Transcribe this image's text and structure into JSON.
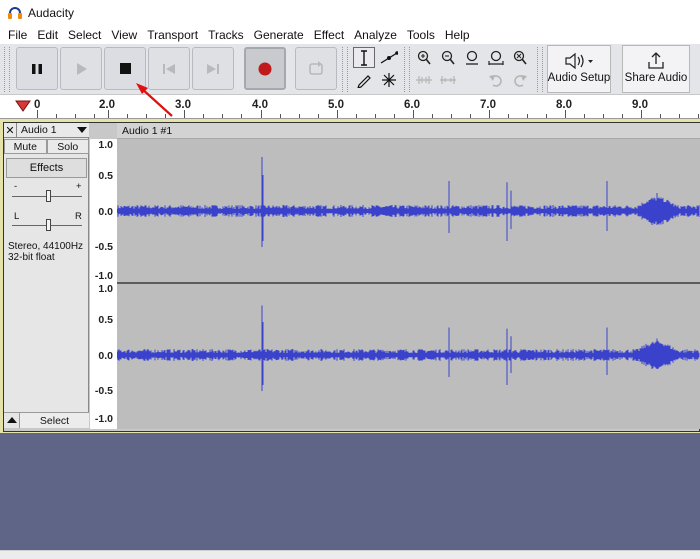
{
  "window": {
    "title": "Audacity"
  },
  "menu": [
    "File",
    "Edit",
    "Select",
    "View",
    "Transport",
    "Tracks",
    "Generate",
    "Effect",
    "Analyze",
    "Tools",
    "Help"
  ],
  "toolbar": {
    "audio_setup_label": "Audio Setup",
    "share_audio_label": "Share Audio"
  },
  "timeline": {
    "labels": [
      "0",
      "2.0",
      "3.0",
      "4.0",
      "5.0",
      "6.0",
      "7.0",
      "8.0",
      "9.0"
    ]
  },
  "track": {
    "name": "Audio 1",
    "mute_label": "Mute",
    "solo_label": "Solo",
    "effects_label": "Effects",
    "gain_minus": "-",
    "gain_plus": "+",
    "pan_left": "L",
    "pan_right": "R",
    "format_line1": "Stereo, 44100Hz",
    "format_line2": "32-bit float",
    "select_label": "Select",
    "clip_name": "Audio 1 #1"
  },
  "amplitude_labels": [
    "1.0",
    "0.5",
    "0.0",
    "-0.5",
    "-1.0"
  ],
  "colors": {
    "waveform": "#3a42cc",
    "waveform_bg": "#bdbdbd",
    "track_selected_border": "#e6e3a8",
    "empty_area": "#5f6586",
    "record_red": "#c01a1a",
    "annotation_arrow": "#e01010"
  }
}
